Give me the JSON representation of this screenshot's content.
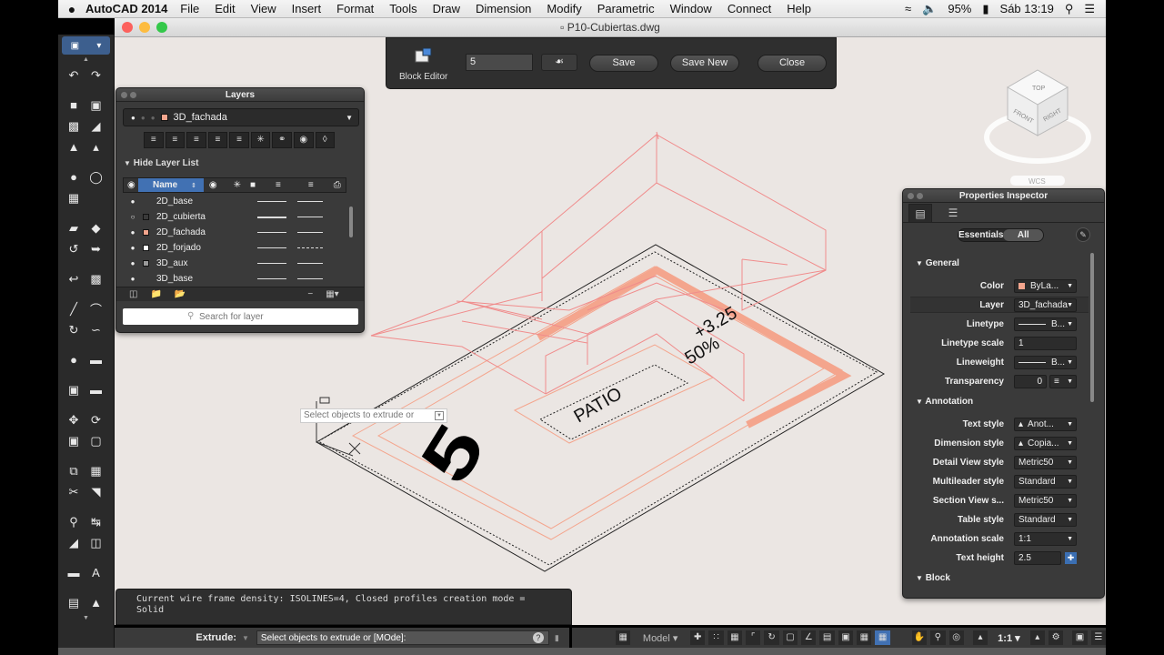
{
  "menubar": {
    "apple": "",
    "app": "AutoCAD 2014",
    "menus": [
      "File",
      "Edit",
      "View",
      "Insert",
      "Format",
      "Tools",
      "Draw",
      "Dimension",
      "Modify",
      "Parametric",
      "Window",
      "Connect",
      "Help"
    ],
    "battery": "95%",
    "clock": "Sáb 13:19"
  },
  "window": {
    "title": "P10-Cubiertas.dwg"
  },
  "block_editor": {
    "label": "Block Editor",
    "name_value": "5",
    "save": "Save",
    "save_new": "Save New",
    "close": "Close"
  },
  "layers": {
    "title": "Layers",
    "current_layer": "3D_fachada",
    "hide_list": "Hide Layer List",
    "col_name": "Name",
    "rows": [
      {
        "name": "2D_base",
        "color": "#cccccc"
      },
      {
        "name": "2D_cubierta",
        "color": "#3a3a3a"
      },
      {
        "name": "2D_fachada",
        "color": "#f4a58d"
      },
      {
        "name": "2D_forjado",
        "color": "#ffffff"
      },
      {
        "name": "3D_aux",
        "color": "#999999"
      },
      {
        "name": "3D_base",
        "color": "#3a3a3a"
      }
    ],
    "search_placeholder": "Search for layer"
  },
  "properties": {
    "title": "Properties Inspector",
    "essentials": "Essentials",
    "all": "All",
    "general": "General",
    "annotation": "Annotation",
    "block": "Block",
    "general_rows": [
      {
        "label": "Color",
        "value": "ByLa..."
      },
      {
        "label": "Layer",
        "value": "3D_fachada"
      },
      {
        "label": "Linetype",
        "value": "B..."
      },
      {
        "label": "Linetype scale",
        "value": "1"
      },
      {
        "label": "Lineweight",
        "value": "B..."
      },
      {
        "label": "Transparency",
        "value": "0"
      }
    ],
    "annotation_rows": [
      {
        "label": "Text style",
        "value": "Anot..."
      },
      {
        "label": "Dimension style",
        "value": "Copia..."
      },
      {
        "label": "Detail View style",
        "value": "Metric50"
      },
      {
        "label": "Multileader style",
        "value": "Standard"
      },
      {
        "label": "Section View s...",
        "value": "Metric50"
      },
      {
        "label": "Table style",
        "value": "Standard"
      },
      {
        "label": "Annotation scale",
        "value": "1:1"
      },
      {
        "label": "Text height",
        "value": "2.5"
      }
    ]
  },
  "command": {
    "history_line1": "Current wire frame density:  ISOLINES=4, Closed profiles creation mode =",
    "history_line2": "Solid",
    "prefix": "Extrude:",
    "prompt": "Select objects to extrude or [MOde]:"
  },
  "dynamic_input": {
    "text": "Select objects to extrude or"
  },
  "statusbar": {
    "model": "Model",
    "scale": "1:1"
  },
  "drawing": {
    "label_patio": "PATIO",
    "label_level": "+3.25",
    "label_pct": "50%",
    "label_number": "5",
    "viewcube_top": "TOP",
    "viewcube_front": "FRONT",
    "viewcube_right": "RIGHT",
    "wcs": "WCS",
    "colors": {
      "bg": "#ebe6e3",
      "wire": "#f08c8c",
      "accent": "#f4a58d"
    }
  }
}
